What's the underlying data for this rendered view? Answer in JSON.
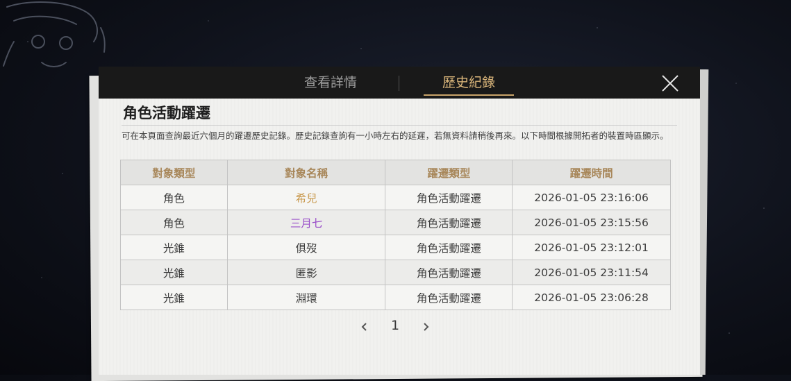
{
  "tabs": [
    {
      "label": "查看詳情",
      "active": false
    },
    {
      "label": "歷史紀錄",
      "active": true
    }
  ],
  "page_title": "角色活動躍遷",
  "notice": "可在本頁面查詢最近六個月的躍遷歷史記錄。歷史記錄查詢有一小時左右的延遲，若無資料請稍後再來。以下時間根據開拓者的裝置時區顯示。",
  "table": {
    "headers": [
      "對象類型",
      "對象名稱",
      "躍遷類型",
      "躍遷時間"
    ],
    "rows": [
      {
        "type": "角色",
        "name": "希兒",
        "warp": "角色活動躍遷",
        "time": "2026-01-05 23:16:06"
      },
      {
        "type": "角色",
        "name": "三月七",
        "warp": "角色活動躍遷",
        "time": "2026-01-05 23:15:56"
      },
      {
        "type": "光錐",
        "name": "俱歿",
        "warp": "角色活動躍遷",
        "time": "2026-01-05 23:12:01"
      },
      {
        "type": "光錐",
        "name": "匿影",
        "warp": "角色活動躍遷",
        "time": "2026-01-05 23:11:54"
      },
      {
        "type": "光錐",
        "name": "淵環",
        "warp": "角色活動躍遷",
        "time": "2026-01-05 23:06:28"
      }
    ]
  },
  "pagination": {
    "current_page": "1"
  },
  "colors": {
    "header_bg": "#191919",
    "active_tab": "#d9b57a",
    "table_header_text": "#a8875a",
    "rarity_5_star": "#c99a4f",
    "rarity_4_star": "#9a4fc9"
  },
  "icons": {
    "close": "close-icon",
    "prev": "chevron-left-icon",
    "next": "chevron-right-icon"
  }
}
